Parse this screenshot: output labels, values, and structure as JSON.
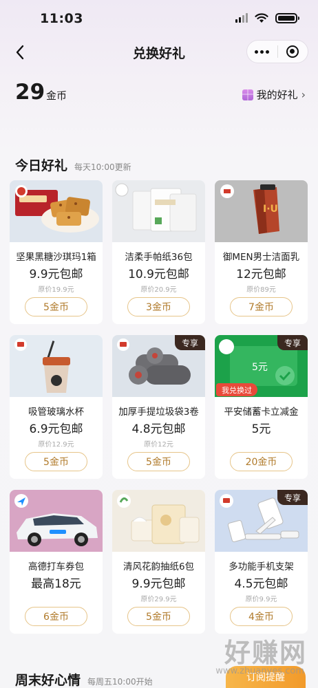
{
  "status_bar": {
    "time": "11:03"
  },
  "nav": {
    "title": "兑换好礼"
  },
  "wallet": {
    "coins": "29",
    "unit": "金币",
    "my_gifts_label": "我的好礼",
    "chevron": "›"
  },
  "today": {
    "title": "今日好礼",
    "subtitle": "每天10:00更新"
  },
  "items": [
    {
      "name": "坚果黑糖沙琪玛1箱",
      "price": "9.9元包邮",
      "original": "原价19.9元",
      "button": "5金币",
      "exclusive": "",
      "redeemed": ""
    },
    {
      "name": "洁柔手帕纸36包",
      "price": "10.9元包邮",
      "original": "原价20.9元",
      "button": "3金币",
      "exclusive": "",
      "redeemed": ""
    },
    {
      "name": "御MEN男士洁面乳",
      "price": "12元包邮",
      "original": "原价89元",
      "button": "7金币",
      "exclusive": "",
      "redeemed": ""
    },
    {
      "name": "吸管玻璃水杯",
      "price": "6.9元包邮",
      "original": "原价12.9元",
      "button": "5金币",
      "exclusive": "",
      "redeemed": ""
    },
    {
      "name": "加厚手提垃圾袋3卷",
      "price": "4.8元包邮",
      "original": "原价12元",
      "button": "5金币",
      "exclusive": "专享",
      "redeemed": ""
    },
    {
      "name": "平安储蓄卡立减金",
      "price": "5元",
      "original": "",
      "button": "20金币",
      "exclusive": "专享",
      "redeemed": "我兑换过",
      "card_text": "5元"
    },
    {
      "name": "高德打车券包",
      "price": "最高18元",
      "original": "",
      "button": "6金币",
      "exclusive": "",
      "redeemed": ""
    },
    {
      "name": "清风花韵抽纸6包",
      "price": "9.9元包邮",
      "original": "原价29.9元",
      "button": "5金币",
      "exclusive": "",
      "redeemed": ""
    },
    {
      "name": "多功能手机支架",
      "price": "4.5元包邮",
      "original": "原价9.9元",
      "button": "4金币",
      "exclusive": "专享",
      "redeemed": ""
    }
  ],
  "weekend": {
    "title": "周末好心情",
    "subtitle": "每周五10:00开始",
    "subscribe_label": "订阅提醒"
  },
  "watermark": {
    "text": "好赚网",
    "url": "www.zhuanyes.com"
  },
  "colors": {
    "accent_gold": "#b07a2a",
    "button_border": "#e6c488",
    "exclusive_tag": "#3b2820",
    "redeemed_tag": "#e94a3a",
    "subscribe": "#f2a83a"
  }
}
